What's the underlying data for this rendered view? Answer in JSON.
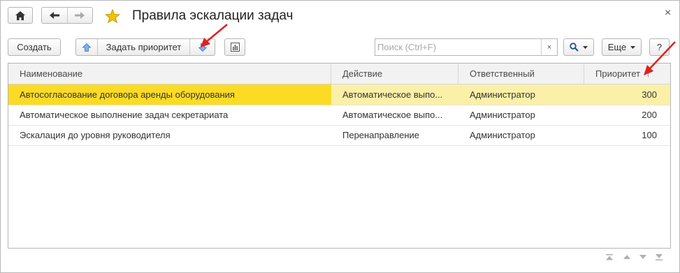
{
  "window": {
    "title": "Правила эскалации задач",
    "close_glyph": "×"
  },
  "toolbar": {
    "create_label": "Создать",
    "set_priority_label": "Задать приоритет",
    "search_placeholder": "Поиск (Ctrl+F)",
    "search_value": "",
    "search_clear_glyph": "×",
    "more_label": "Еще",
    "help_label": "?"
  },
  "table": {
    "columns": [
      "Наименование",
      "Действие",
      "Ответственный",
      "Приоритет"
    ],
    "sort_indicator": "↑",
    "rows": [
      {
        "name": "Автосогласование договора аренды оборудования",
        "action": "Автоматическое выпо...",
        "responsible": "Администратор",
        "priority": "300",
        "selected": true
      },
      {
        "name": "Автоматическое выполнение задач секретариата",
        "action": "Автоматическое выпо...",
        "responsible": "Администратор",
        "priority": "200",
        "selected": false
      },
      {
        "name": "Эскалация до уровня руководителя",
        "action": "Перенаправление",
        "responsible": "Администратор",
        "priority": "100",
        "selected": false
      }
    ]
  },
  "colors": {
    "selected_row": "#fcdb25",
    "selected_row_light": "#fbf0a8",
    "priority_arrow": "#5b8fd8",
    "annotation_arrow": "#e02020",
    "favorite_star": "#f2c200"
  },
  "icons": [
    "home-icon",
    "back-arrow-icon",
    "forward-arrow-icon",
    "star-icon",
    "move-up-icon",
    "move-down-icon",
    "report-icon",
    "search-icon",
    "dropdown-icon",
    "nav-first-icon",
    "nav-up-icon",
    "nav-down-icon",
    "nav-last-icon"
  ]
}
